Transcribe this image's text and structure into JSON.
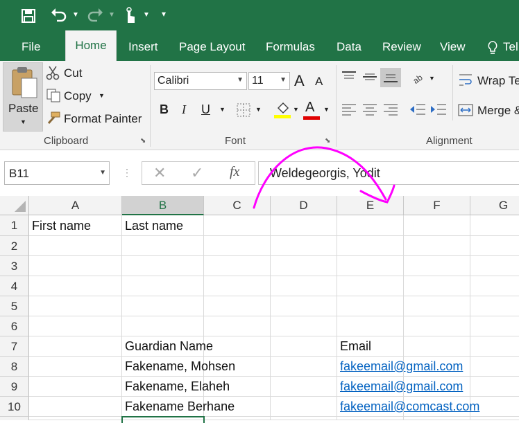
{
  "tabs": [
    {
      "label": "File"
    },
    {
      "label": "Home"
    },
    {
      "label": "Insert"
    },
    {
      "label": "Page Layout"
    },
    {
      "label": "Formulas"
    },
    {
      "label": "Data"
    },
    {
      "label": "Review"
    },
    {
      "label": "View"
    },
    {
      "label": "Tel"
    }
  ],
  "clipboard": {
    "paste_label": "Paste",
    "cut_label": "Cut",
    "copy_label": "Copy",
    "format_painter_label": "Format Painter",
    "group_label": "Clipboard"
  },
  "font": {
    "font_name": "Calibri",
    "font_size": "11",
    "group_label": "Font",
    "bold": "B",
    "italic": "I",
    "underline": "U",
    "grow": "A",
    "shrink": "A",
    "font_color_letter": "A",
    "highlight_color": "#ffff00",
    "font_color": "#e00000"
  },
  "alignment": {
    "wrap_label": "Wrap Te",
    "merge_label": "Merge &",
    "group_label": "Alignment"
  },
  "formula_bar": {
    "name_box": "B11",
    "fx": "fx",
    "value": "Weldegeorgis, Yodit"
  },
  "columns": [
    "A",
    "B",
    "C",
    "D",
    "E",
    "F",
    "G"
  ],
  "rows": [
    "1",
    "2",
    "3",
    "4",
    "5",
    "6",
    "7",
    "8",
    "9",
    "10"
  ],
  "cells": {
    "A1": "First name",
    "B1": "Last name",
    "B7": "Guardian Name",
    "E7": "Email",
    "B8": "Fakename, Mohsen",
    "E8": "fakeemail@gmail.com",
    "B9": "Fakename, Elaheh",
    "E9": "fakeemail@gmail.com",
    "B10": "Fakename Berhane",
    "E10": "fakeemail@comcast.com"
  },
  "colors": {
    "excel_green": "#217346",
    "annotation": "#ff00ff",
    "link": "#0563c1"
  }
}
